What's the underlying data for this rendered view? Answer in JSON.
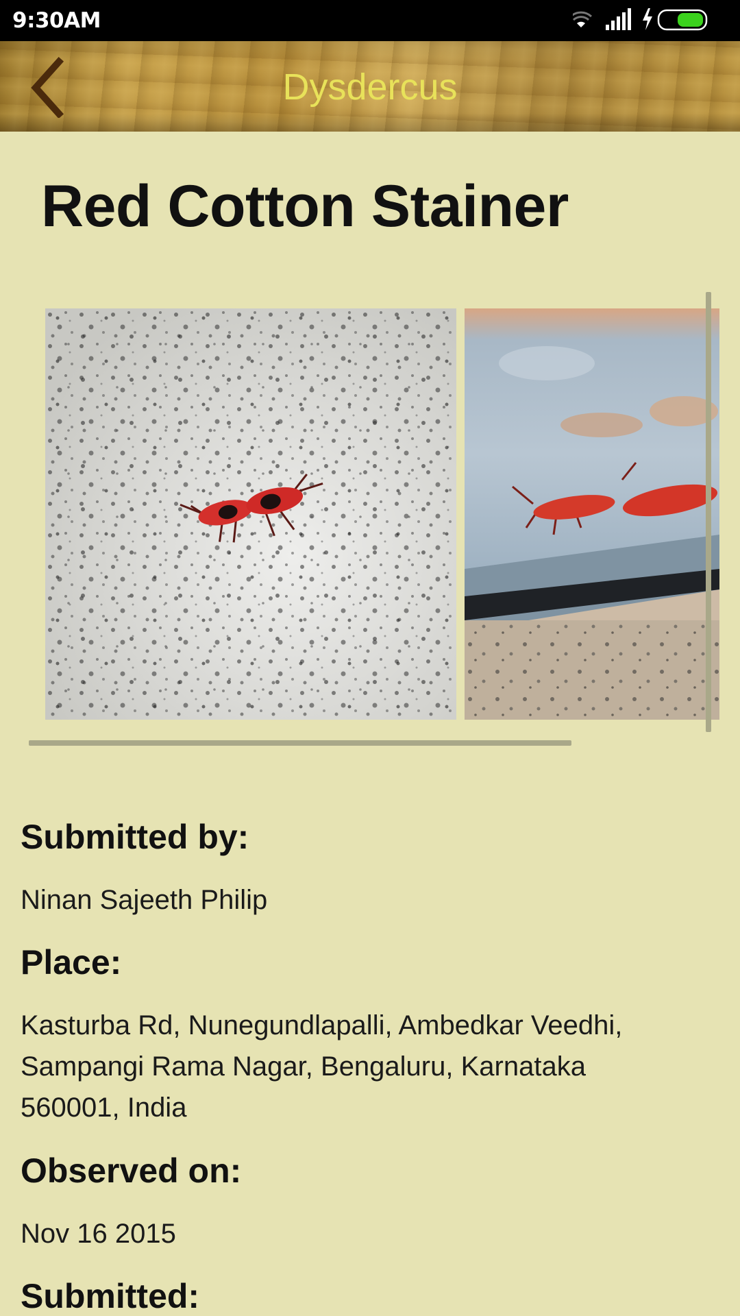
{
  "status_bar": {
    "time": "9:30AM",
    "icons": [
      "wifi-icon",
      "signal-icon",
      "charging-icon",
      "battery-icon"
    ],
    "battery_color": "#3bd21d"
  },
  "app_bar": {
    "title": "Dysdercus",
    "back_icon": "chevron-left-icon",
    "title_color": "#e8e25a"
  },
  "species": {
    "common_name": "Red Cotton Stainer"
  },
  "gallery": {
    "photo_count_visible": 2
  },
  "details": {
    "submitted_by_label": "Submitted by:",
    "submitted_by_value": "Ninan Sajeeth Philip",
    "place_label": "Place:",
    "place_value": "Kasturba Rd, Nunegundlapalli, Ambedkar Veedhi, Sampangi Rama Nagar, Bengaluru, Karnataka 560001, India",
    "observed_label": "Observed on:",
    "observed_value": "Nov 16 2015",
    "submitted_label": "Submitted:"
  },
  "colors": {
    "background": "#e6e3b3",
    "scrollbar": "#a9a889"
  }
}
